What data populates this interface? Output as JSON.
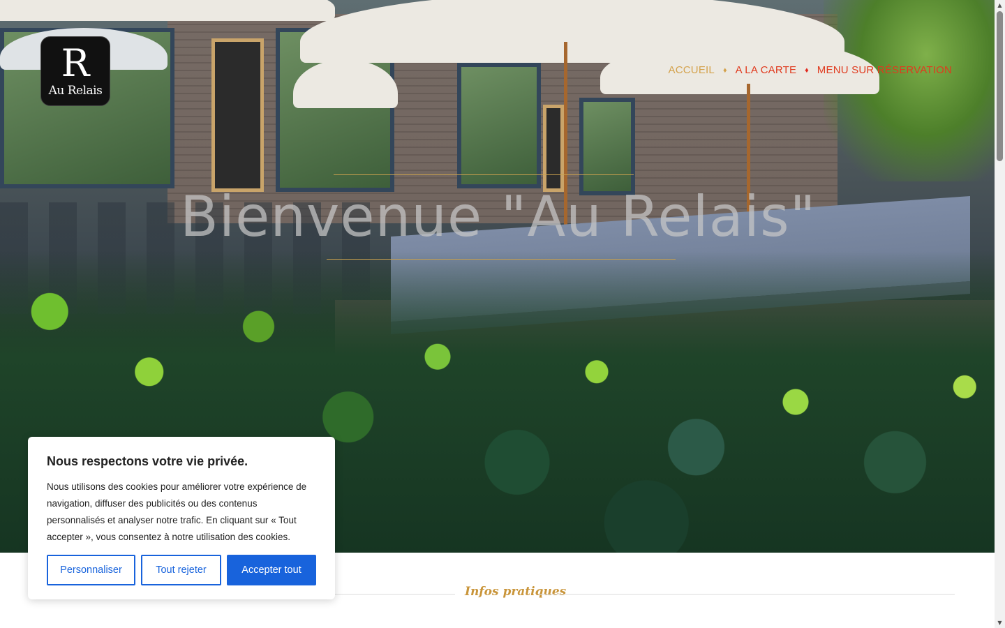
{
  "logo": {
    "letter": "R",
    "name": "Au Relais"
  },
  "nav": {
    "items": [
      {
        "label": "ACCUEIL",
        "active": true
      },
      {
        "label": "A LA CARTE",
        "active": false
      },
      {
        "label": "MENU SUR RÉSERVATION",
        "active": false
      }
    ],
    "separator": "♦"
  },
  "hero": {
    "title": "Bienvenue \"Au Relais\""
  },
  "infos": {
    "title": "Infos pratiques"
  },
  "cookie_banner": {
    "title": "Nous respectons votre vie privée.",
    "text": "Nous utilisons des cookies pour améliorer votre expérience de navigation, diffuser des publicités ou des contenus personnalisés et analyser notre trafic. En cliquant sur « Tout accepter », vous consentez à notre utilisation des cookies.",
    "buttons": {
      "customize": "Personnaliser",
      "reject": "Tout rejeter",
      "accept": "Accepter tout"
    }
  },
  "colors": {
    "accent_gold": "#d4a24c",
    "nav_red": "#e03a1e",
    "cookie_blue": "#1863dc"
  }
}
